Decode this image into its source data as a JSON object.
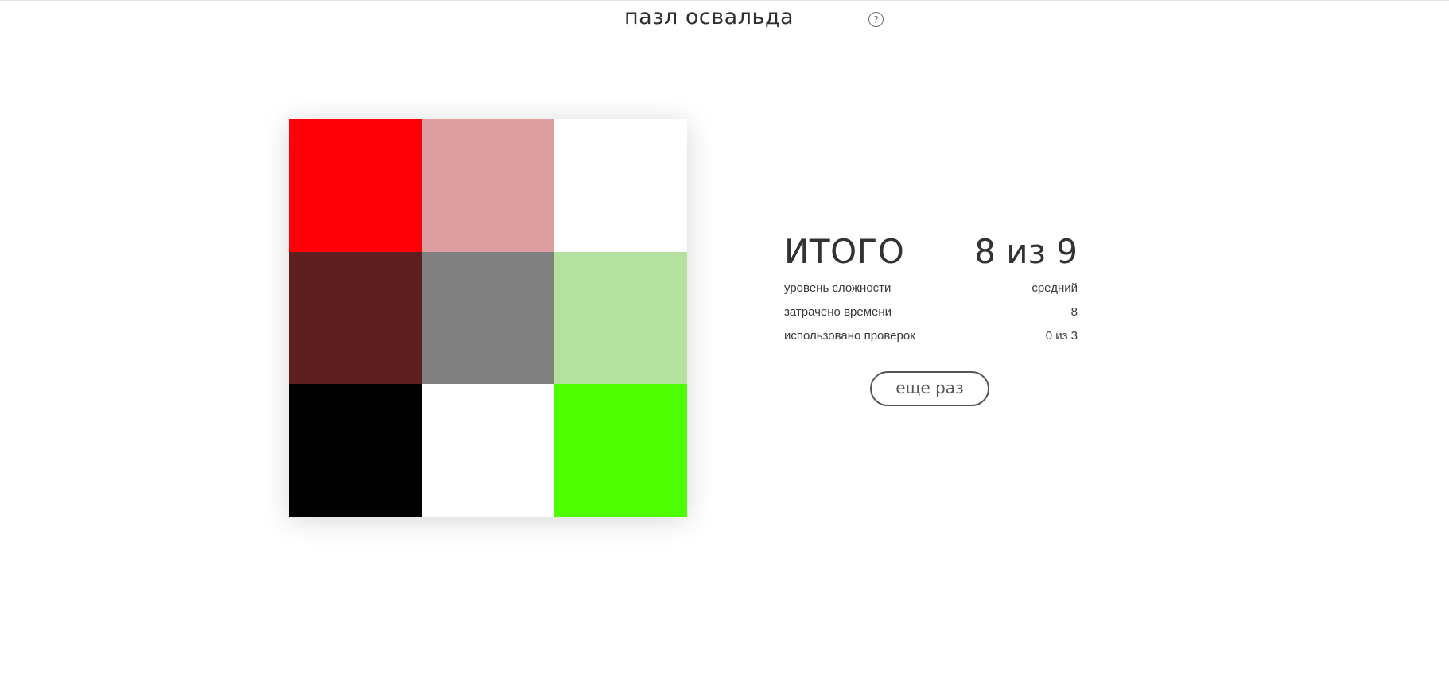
{
  "header": {
    "title": "пазл освальда",
    "help_label": "?"
  },
  "board": {
    "tiles": [
      {
        "color": "#ff0008"
      },
      {
        "color": "#de9ea1"
      },
      {
        "color": "#ffffff"
      },
      {
        "color": "#5e1f21"
      },
      {
        "color": "#808080"
      },
      {
        "color": "#b4e0a0"
      },
      {
        "color": "#000000"
      },
      {
        "color": "#ffffff"
      },
      {
        "color": "#4dff00"
      }
    ]
  },
  "results": {
    "title": "ИТОГО",
    "score": "8 из 9",
    "stats": [
      {
        "label": "уровень сложности",
        "value": "средний"
      },
      {
        "label": "затрачено времени",
        "value": "8"
      },
      {
        "label": "использовано проверок",
        "value": "0 из 3"
      }
    ]
  },
  "actions": {
    "retry_label": "еще раз"
  }
}
